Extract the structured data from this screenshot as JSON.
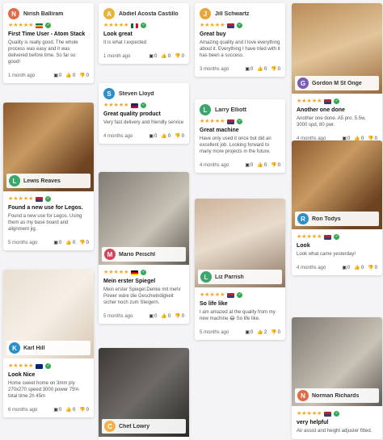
{
  "icons": {
    "thumb_up": "👍",
    "thumb_down": "👎",
    "image": "▣",
    "stars": "★★★★★",
    "check": "✓"
  },
  "columns": [
    [
      {
        "id": "c1",
        "name": "Nirish Balliram",
        "initial": "N",
        "avatar_color": "#e06b47",
        "flag": "za",
        "title": "First Time User - Atom Stack",
        "text": "Quality is really good. The whole process was easy and it was delivered before time. So far so good!",
        "time": "1 month ago",
        "img": "0",
        "up": "0",
        "down": "0"
      },
      {
        "id": "c2",
        "name": "Lewis Reaves",
        "initial": "L",
        "avatar_color": "#3aa76d",
        "flag": "us",
        "photo": true,
        "photo_class": "ph-wood",
        "photo_h": 110,
        "title": "Found a new use for Legos.",
        "text": "Found a new use for Legos. Using them as my base board and alignment jig.",
        "time": "5 months ago",
        "img": "0",
        "up": "0",
        "down": "0"
      },
      {
        "id": "c3",
        "name": "Karl Hill",
        "initial": "K",
        "avatar_color": "#2b8fc9",
        "flag": "au",
        "photo": true,
        "photo_class": "ph-home",
        "photo_h": 110,
        "title": "Look Nice",
        "text": "Home sweet home on 3mm ply 270x270 speed 3000 power 75% total time 2h 45m",
        "time": "6 months ago",
        "img": "0",
        "up": "0",
        "down": "0"
      }
    ],
    [
      {
        "id": "c4",
        "name": "Abdiel Acosta Castillo",
        "initial": "A",
        "avatar_color": "#e8b43a",
        "flag": "mx",
        "title": "Look great",
        "text": "It is what I expected",
        "time": "1 month ago",
        "img": "0",
        "up": "0",
        "down": "0"
      },
      {
        "id": "c5",
        "name": "Steven Lloyd",
        "initial": "S",
        "avatar_color": "#2b8fc9",
        "flag": "gb",
        "title": "Great quality product",
        "text": "Very fast delivery and friendly service",
        "time": "4 months ago",
        "img": "0",
        "up": "0",
        "down": "0"
      },
      {
        "id": "c6",
        "name": "Mario Peischl",
        "initial": "M",
        "avatar_color": "#d6455b",
        "flag": "de",
        "photo": true,
        "photo_class": "ph-gray",
        "photo_h": 115,
        "title": "Mein erster Spiegel",
        "text": "Mein erster Spiegel.Denke mit mehr Power wäre die Geschwindigkeit sicher noch zum Steigern.",
        "time": "5 months ago",
        "img": "0",
        "up": "0",
        "down": "0"
      },
      {
        "id": "c7",
        "name": "Chet Lowry",
        "initial": "C",
        "avatar_color": "#f0b24a",
        "flag": "us",
        "photo": true,
        "photo_class": "ph-dark",
        "photo_h": 110,
        "title": "",
        "text": "",
        "time": "",
        "img": "",
        "up": "",
        "down": ""
      }
    ],
    [
      {
        "id": "c8",
        "name": "Jill Schwartz",
        "initial": "J",
        "avatar_color": "#e8a53a",
        "flag": "us",
        "title": "Great buy",
        "text": "Amazing quality and I love everything about it. Everything I have tried with it has been a success.",
        "time": "3 months ago",
        "img": "0",
        "up": "0",
        "down": "0"
      },
      {
        "id": "c9",
        "name": "Larry Elliott",
        "initial": "L",
        "avatar_color": "#3aa76d",
        "flag": "us",
        "title": "Great machine",
        "text": "Have only used it once but did an excellent job. Looking forward to many more projects in the future.",
        "time": "4 months ago",
        "img": "0",
        "up": "0",
        "down": "0"
      },
      {
        "id": "c10",
        "name": "Liz Parrish",
        "initial": "L",
        "avatar_color": "#3aa76d",
        "flag": "us",
        "photo": true,
        "photo_class": "ph-cat",
        "photo_h": 110,
        "title": "So life like",
        "text": "I am amazed at the quality from my new machine 😂 So life like.",
        "time": "5 months ago",
        "img": "0",
        "up": "2",
        "down": "0"
      }
    ],
    [
      {
        "id": "c11",
        "name": "Gordon M St Onge",
        "initial": "G",
        "avatar_color": "#7a5bb5",
        "flag": "us",
        "photo": true,
        "photo_class": "ph-wood2",
        "photo_h": 112,
        "title": "Another one done",
        "text": "Another one done. A5 pro. 5.5w, 3000 spd, 80 pwr.",
        "time": "4 months ago",
        "img": "0",
        "up": "0",
        "down": "0"
      },
      {
        "id": "c12",
        "name": "Ron Todys",
        "initial": "R",
        "avatar_color": "#2b8fc9",
        "flag": "us",
        "photo": true,
        "photo_class": "ph-wood",
        "photo_h": 110,
        "title": "Look",
        "text": "Look what came yesterday!",
        "time": "4 months ago",
        "img": "0",
        "up": "0",
        "down": "0"
      },
      {
        "id": "c13",
        "name": "Norman Richards",
        "initial": "N",
        "avatar_color": "#e06b47",
        "flag": "us",
        "photo": true,
        "photo_class": "ph-gray",
        "photo_h": 110,
        "title": "very helpful",
        "text": "Air assist and height adjuster fitted.",
        "time": "",
        "img": "",
        "up": "",
        "down": ""
      }
    ]
  ]
}
